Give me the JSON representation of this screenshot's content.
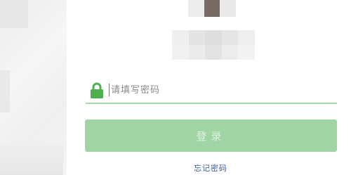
{
  "login": {
    "password_placeholder": "请填写密码",
    "login_button_label": "登录",
    "forgot_password_label": "忘记密码"
  },
  "colors": {
    "accent_green": "#4caf50",
    "button_green": "#a0d4a4",
    "link_blue": "#2e5fa8"
  },
  "icons": {
    "password_icon": "lock-icon"
  }
}
